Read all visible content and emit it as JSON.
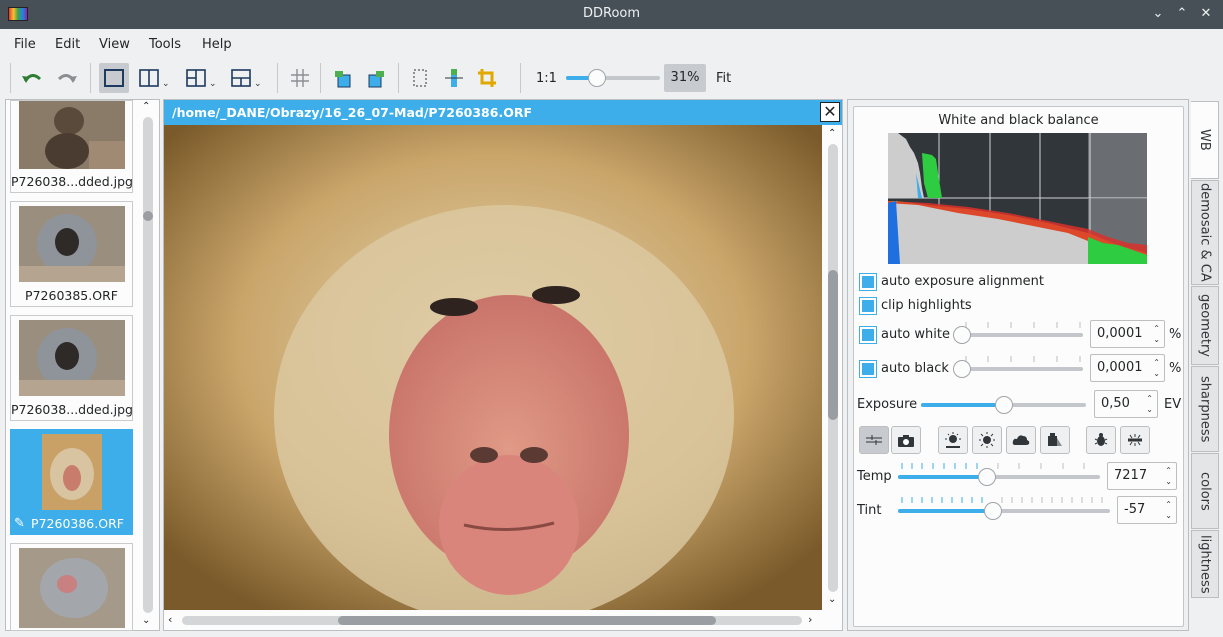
{
  "window": {
    "title": "DDRoom"
  },
  "menu": [
    "File",
    "Edit",
    "View",
    "Tools",
    "Help"
  ],
  "toolbar": {
    "zoom_1to1": "1:1",
    "zoom_value": "31%",
    "fit": "Fit",
    "zoom_level": 0.31
  },
  "thumbnails": [
    {
      "label": "P726038...dded.jpg"
    },
    {
      "label": "P7260385.ORF"
    },
    {
      "label": "P726038...dded.jpg"
    },
    {
      "label": "P7260386.ORF",
      "selected": true,
      "edited": true
    },
    {
      "label": ""
    }
  ],
  "viewer": {
    "path": "/home/_DANE/Obrazy/16_26_07-Mad/P7260386.ORF",
    "close": "✕"
  },
  "wb_panel": {
    "title": "White and black balance",
    "auto_exposure_alignment": "auto exposure alignment",
    "clip_highlights": "clip highlights",
    "auto_white": {
      "label": "auto white",
      "value": "0,0001",
      "unit": "%",
      "level": 0
    },
    "auto_black": {
      "label": "auto black",
      "value": "0,0001",
      "unit": "%",
      "level": 0
    },
    "exposure": {
      "label": "Exposure",
      "value": "0,50",
      "unit": "EV",
      "level": 0.5
    },
    "temp": {
      "label": "Temp",
      "value": "7217",
      "level": 0.44
    },
    "tint": {
      "label": "Tint",
      "value": "-57",
      "level": 0.45
    }
  },
  "tabs": [
    "WB",
    "demosaic & CA",
    "geometry",
    "sharpness",
    "colors",
    "lightness"
  ],
  "colors": {
    "accent": "#3daee9",
    "titlebar": "#475057"
  }
}
